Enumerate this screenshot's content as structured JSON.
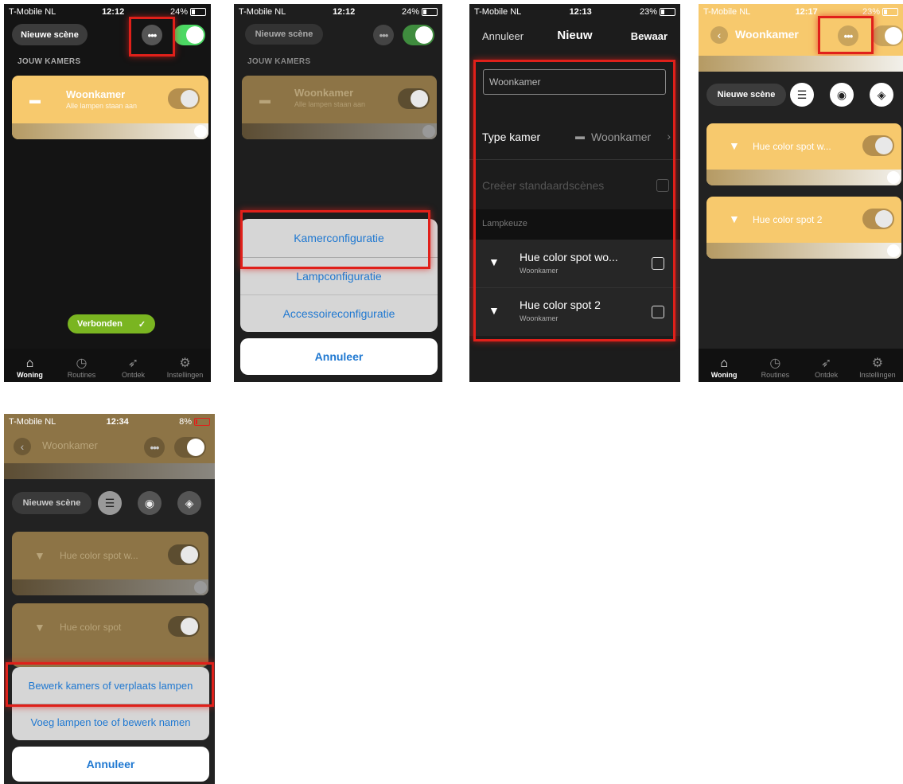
{
  "colors": {
    "accent_blue": "#1f78d1",
    "toggle_green": "#4cd964",
    "card_yellow": "#f7c96d",
    "highlight_red": "#e0201a",
    "connected_green": "#7ab521"
  },
  "screen1": {
    "status": {
      "carrier": "T-Mobile NL",
      "time": "12:12",
      "battery": "24%"
    },
    "new_scene_button": "Nieuwe scène",
    "more_button": "•••",
    "section_title": "JOUW KAMERS",
    "room": {
      "name": "Woonkamer",
      "status": "Alle lampen staan aan"
    },
    "connected_badge": "Verbonden",
    "tabs": [
      "Woning",
      "Routines",
      "Ontdek",
      "Instellingen"
    ]
  },
  "screen2": {
    "status": {
      "carrier": "T-Mobile NL",
      "time": "12:12",
      "battery": "24%"
    },
    "new_scene_button": "Nieuwe scène",
    "more_button": "•••",
    "section_title": "JOUW KAMERS",
    "room": {
      "name": "Woonkamer",
      "status": "Alle lampen staan aan"
    },
    "sheet": [
      "Kamerconfiguratie",
      "Lampconfiguratie",
      "Accessoireconfiguratie"
    ],
    "cancel": "Annuleer",
    "tabs": [
      "Woning",
      "Routines",
      "Ontdek",
      "Instellingen"
    ]
  },
  "screen3": {
    "status": {
      "carrier": "T-Mobile NL",
      "time": "12:13",
      "battery": "23%"
    },
    "cancel": "Annuleer",
    "title": "Nieuw",
    "save": "Bewaar",
    "name_field": "Woonkamer",
    "type_label": "Type kamer",
    "type_value": "Woonkamer",
    "create_scenes": "Creëer standaardscènes",
    "lamp_section": "Lampkeuze",
    "lamps": [
      {
        "name": "Hue color spot wo...",
        "room": "Woonkamer"
      },
      {
        "name": "Hue color spot 2",
        "room": "Woonkamer"
      }
    ]
  },
  "screen4": {
    "status": {
      "carrier": "T-Mobile NL",
      "time": "12:17",
      "battery": "23%"
    },
    "title": "Woonkamer",
    "more_button": "•••",
    "new_scene_button": "Nieuwe scène",
    "lamps": [
      "Hue color spot w...",
      "Hue color spot 2"
    ],
    "tabs": [
      "Woning",
      "Routines",
      "Ontdek",
      "Instellingen"
    ]
  },
  "screen5": {
    "status": {
      "carrier": "T-Mobile NL",
      "time": "12:34",
      "battery": "8%"
    },
    "title": "Woonkamer",
    "more_button": "•••",
    "new_scene_button": "Nieuwe scène",
    "lamps": [
      "Hue color spot w...",
      "Hue color spot"
    ],
    "sheet": [
      "Bewerk kamers of verplaats lampen",
      "Voeg lampen toe of bewerk namen"
    ],
    "cancel": "Annuleer"
  }
}
